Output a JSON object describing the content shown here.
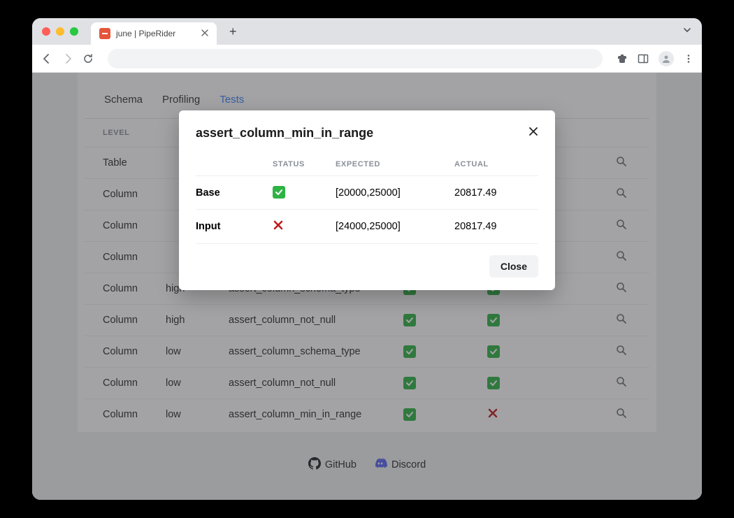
{
  "browser": {
    "tab_title": "june | PipeRider"
  },
  "tabs": [
    {
      "label": "Schema",
      "active": false
    },
    {
      "label": "Profiling",
      "active": false
    },
    {
      "label": "Tests",
      "active": true
    }
  ],
  "table": {
    "header": {
      "level": "LEVEL"
    },
    "rows": [
      {
        "level": "Table",
        "col": "",
        "assert": "",
        "base": "pass",
        "input": "pass"
      },
      {
        "level": "Column",
        "col": "",
        "assert": "",
        "base": "pass",
        "input": "pass"
      },
      {
        "level": "Column",
        "col": "",
        "assert": "",
        "base": "pass",
        "input": "pass"
      },
      {
        "level": "Column",
        "col": "",
        "assert": "",
        "base": "pass",
        "input": "pass"
      },
      {
        "level": "Column",
        "col": "high",
        "assert": "assert_column_schema_type",
        "base": "pass",
        "input": "pass"
      },
      {
        "level": "Column",
        "col": "high",
        "assert": "assert_column_not_null",
        "base": "pass",
        "input": "pass"
      },
      {
        "level": "Column",
        "col": "low",
        "assert": "assert_column_schema_type",
        "base": "pass",
        "input": "pass"
      },
      {
        "level": "Column",
        "col": "low",
        "assert": "assert_column_not_null",
        "base": "pass",
        "input": "pass"
      },
      {
        "level": "Column",
        "col": "low",
        "assert": "assert_column_min_in_range",
        "base": "pass",
        "input": "fail"
      }
    ]
  },
  "footer": {
    "github": "GitHub",
    "discord": "Discord"
  },
  "modal": {
    "title": "assert_column_min_in_range",
    "headers": {
      "status": "STATUS",
      "expected": "EXPECTED",
      "actual": "ACTUAL"
    },
    "rows": [
      {
        "label": "Base",
        "status": "pass",
        "expected": "[20000,25000]",
        "actual": "20817.49"
      },
      {
        "label": "Input",
        "status": "fail",
        "expected": "[24000,25000]",
        "actual": "20817.49"
      }
    ],
    "close": "Close"
  }
}
